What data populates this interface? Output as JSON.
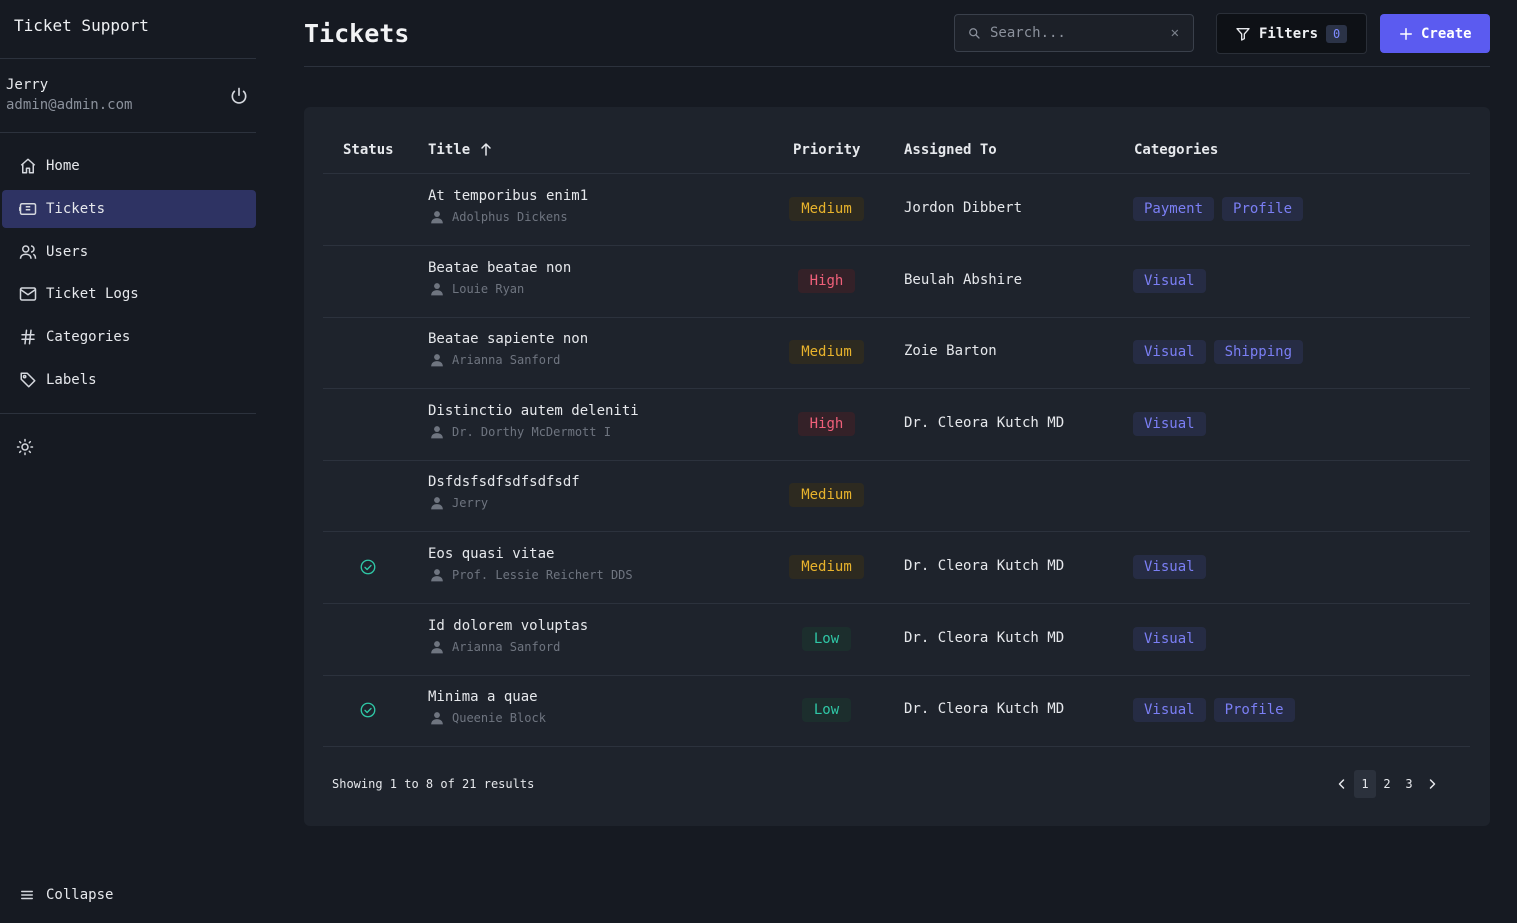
{
  "app": {
    "title": "Ticket Support"
  },
  "user": {
    "name": "Jerry",
    "email": "admin@admin.com"
  },
  "nav": [
    {
      "label": "Home",
      "icon": "home-icon"
    },
    {
      "label": "Tickets",
      "icon": "ticket-icon",
      "active": true
    },
    {
      "label": "Users",
      "icon": "users-icon"
    },
    {
      "label": "Ticket Logs",
      "icon": "mail-icon"
    },
    {
      "label": "Categories",
      "icon": "hash-icon"
    },
    {
      "label": "Labels",
      "icon": "tag-icon"
    }
  ],
  "sidebar_footer": {
    "collapse_label": "Collapse"
  },
  "header": {
    "title": "Tickets",
    "search_placeholder": "Search...",
    "filters_label": "Filters",
    "filters_count": "0",
    "create_label": "Create"
  },
  "table": {
    "columns": {
      "status": "Status",
      "title": "Title",
      "priority": "Priority",
      "assigned": "Assigned To",
      "categories": "Categories"
    },
    "rows": [
      {
        "resolved": false,
        "title": "At temporibus enim1",
        "author": "Adolphus Dickens",
        "priority": "Medium",
        "assigned": "Jordon Dibbert",
        "categories": [
          "Payment",
          "Profile"
        ]
      },
      {
        "resolved": false,
        "title": "Beatae beatae non",
        "author": "Louie Ryan",
        "priority": "High",
        "assigned": "Beulah Abshire",
        "categories": [
          "Visual"
        ]
      },
      {
        "resolved": false,
        "title": "Beatae sapiente non",
        "author": "Arianna Sanford",
        "priority": "Medium",
        "assigned": "Zoie Barton",
        "categories": [
          "Visual",
          "Shipping"
        ]
      },
      {
        "resolved": false,
        "title": "Distinctio autem deleniti",
        "author": "Dr. Dorthy McDermott I",
        "priority": "High",
        "assigned": "Dr. Cleora Kutch MD",
        "categories": [
          "Visual"
        ]
      },
      {
        "resolved": false,
        "title": "Dsfdsfsdfsdfsdfsdf",
        "author": "Jerry",
        "priority": "Medium",
        "assigned": "",
        "categories": []
      },
      {
        "resolved": true,
        "title": "Eos quasi vitae",
        "author": "Prof. Lessie Reichert DDS",
        "priority": "Medium",
        "assigned": "Dr. Cleora Kutch MD",
        "categories": [
          "Visual"
        ]
      },
      {
        "resolved": false,
        "title": "Id dolorem voluptas",
        "author": "Arianna Sanford",
        "priority": "Low",
        "assigned": "Dr. Cleora Kutch MD",
        "categories": [
          "Visual"
        ]
      },
      {
        "resolved": true,
        "title": "Minima a quae",
        "author": "Queenie Block",
        "priority": "Low",
        "assigned": "Dr. Cleora Kutch MD",
        "categories": [
          "Visual",
          "Profile"
        ]
      }
    ]
  },
  "footer": {
    "showing_text": "Showing 1 to 8 of 21 results",
    "pages": [
      "1",
      "2",
      "3"
    ],
    "current_page": "1"
  },
  "colors": {
    "accent": "#5b5bf0",
    "background": "#161a22",
    "card": "#1e232c",
    "medium": "#e8b32c",
    "high": "#f0607a",
    "low": "#2fc7a6",
    "category": "#7b7ff5"
  }
}
